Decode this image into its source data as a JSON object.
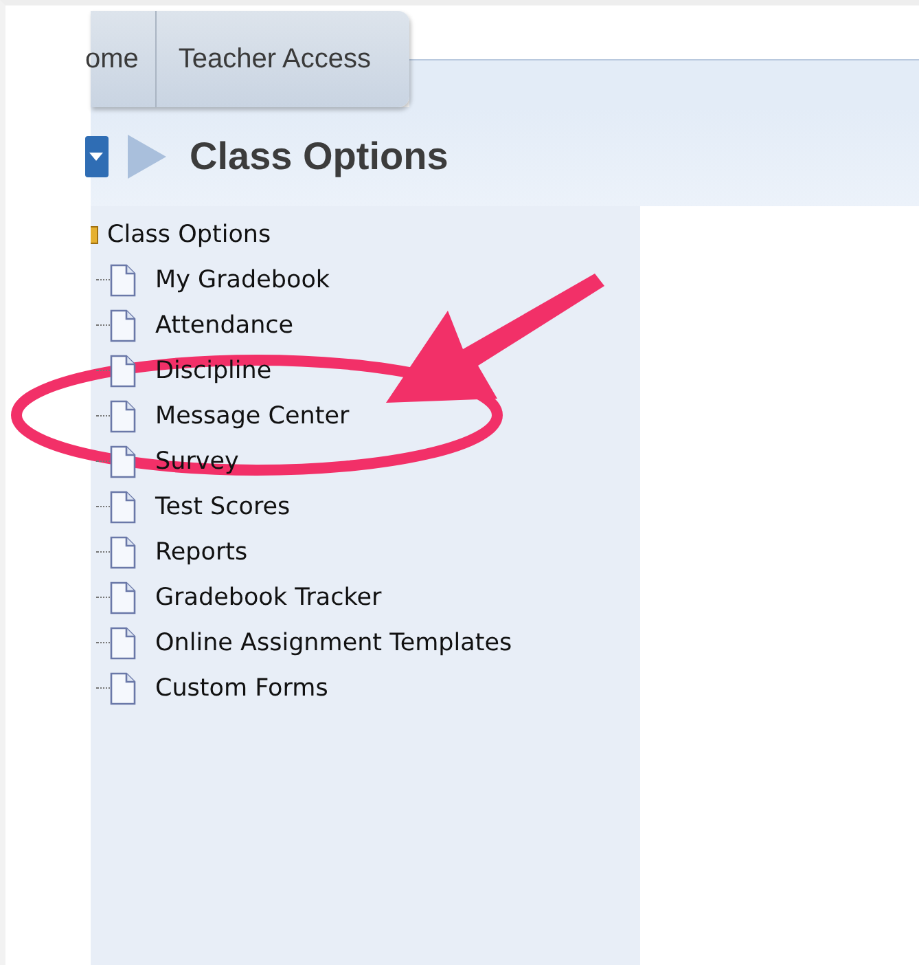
{
  "tabs": [
    {
      "label": "ome",
      "selected": false
    },
    {
      "label": "Teacher Access",
      "selected": false
    }
  ],
  "page_title": "Class Options",
  "tree": {
    "label": "Class Options",
    "expanded": true,
    "children": [
      {
        "label": "My Gradebook"
      },
      {
        "label": "Attendance"
      },
      {
        "label": "Discipline"
      },
      {
        "label": "Message Center"
      },
      {
        "label": "Survey"
      },
      {
        "label": "Test Scores"
      },
      {
        "label": "Reports"
      },
      {
        "label": "Gradebook Tracker"
      },
      {
        "label": "Online Assignment Templates"
      },
      {
        "label": "Custom Forms"
      }
    ]
  }
}
